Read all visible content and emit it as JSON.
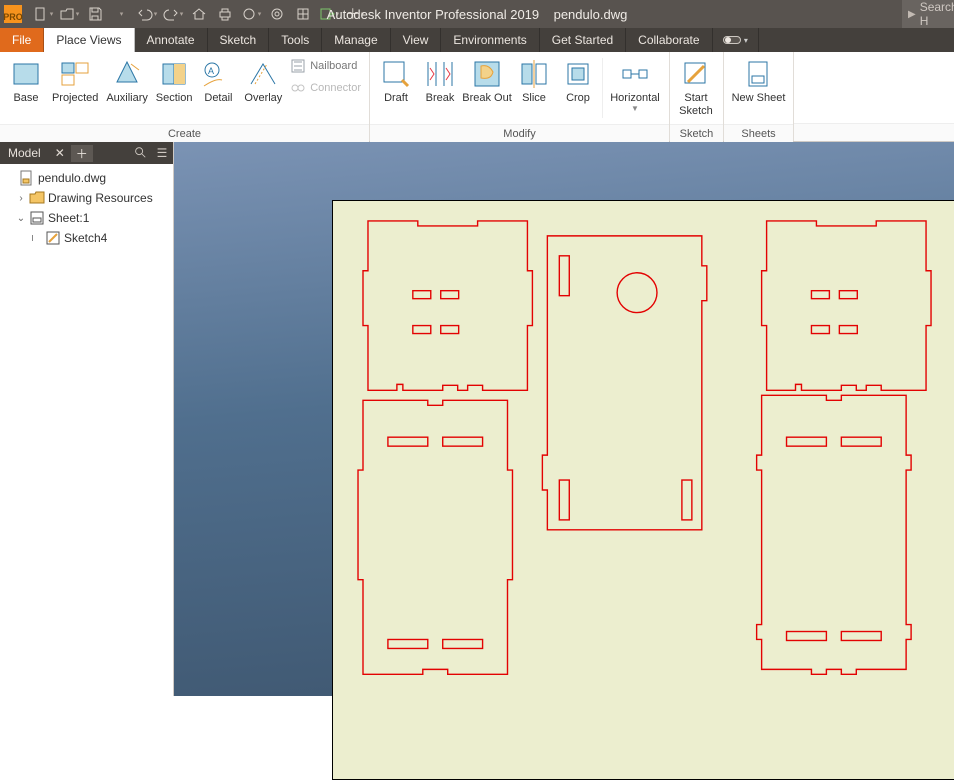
{
  "app": {
    "title_prefix": "Autodesk Inventor Professional 2019",
    "document": "pendulo.dwg",
    "search_placeholder": "Search H"
  },
  "qat": {
    "items": [
      "new",
      "open",
      "save",
      "undo",
      "redo",
      "home",
      "print",
      "color",
      "material",
      "appearance",
      "export",
      "plus"
    ]
  },
  "tabs": {
    "file": "File",
    "items": [
      "Place Views",
      "Annotate",
      "Sketch",
      "Tools",
      "Manage",
      "View",
      "Environments",
      "Get Started",
      "Collaborate"
    ],
    "active_index": 0
  },
  "ribbon": {
    "panels": [
      {
        "caption": "Create",
        "buttons": [
          "Base",
          "Projected",
          "Auxiliary",
          "Section",
          "Detail",
          "Overlay"
        ],
        "stack": [
          {
            "label": "Nailboard"
          },
          {
            "label": "Connector"
          }
        ]
      },
      {
        "caption": "Modify",
        "buttons": [
          "Draft",
          "Break",
          "Break Out",
          "Slice",
          "Crop"
        ],
        "extra": [
          {
            "label": "Horizontal",
            "dropdown": true
          }
        ]
      },
      {
        "caption": "Sketch",
        "buttons": [
          {
            "label": "Start\nSketch"
          }
        ]
      },
      {
        "caption": "Sheets",
        "buttons": [
          {
            "label": "New Sheet"
          }
        ]
      }
    ]
  },
  "browser": {
    "title": "Model",
    "tree": [
      {
        "level": 0,
        "icon": "doc",
        "label": "pendulo.dwg",
        "twisty": ""
      },
      {
        "level": 1,
        "icon": "folder",
        "label": "Drawing Resources",
        "twisty": ">"
      },
      {
        "level": 1,
        "icon": "sheet",
        "label": "Sheet:1",
        "twisty": "v"
      },
      {
        "level": 2,
        "icon": "sketch",
        "label": "Sketch4",
        "twisty": ""
      }
    ]
  }
}
